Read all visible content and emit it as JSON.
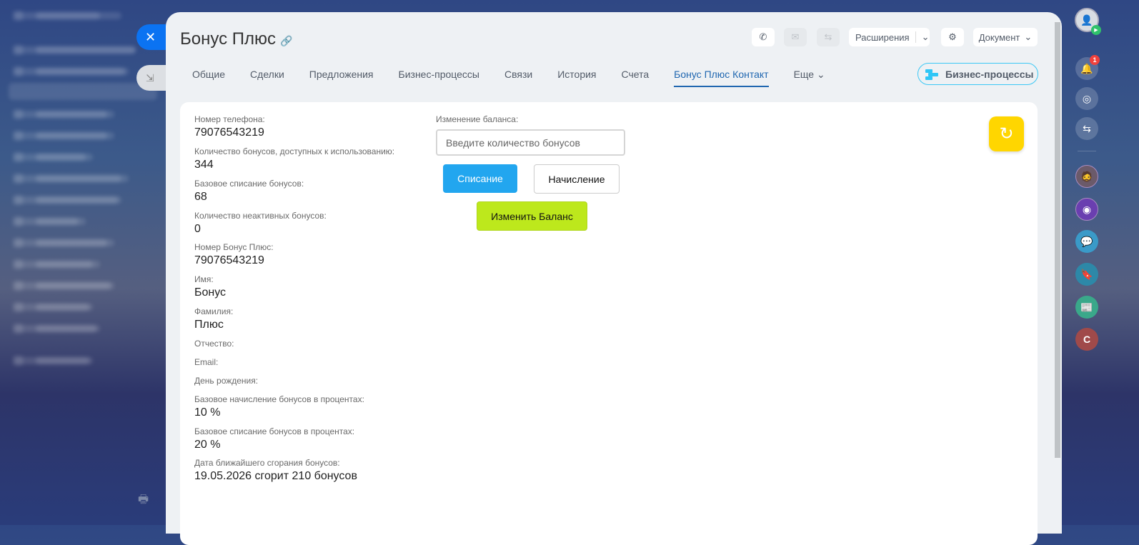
{
  "header": {
    "title": "Бонус Плюс",
    "toolbar": {
      "extensions": "Расширения",
      "document": "Документ"
    }
  },
  "tabs": [
    {
      "label": "Общие"
    },
    {
      "label": "Сделки"
    },
    {
      "label": "Предложения"
    },
    {
      "label": "Бизнес-процессы"
    },
    {
      "label": "Связи"
    },
    {
      "label": "История"
    },
    {
      "label": "Счета"
    },
    {
      "label": "Бонус Плюс Контакт"
    },
    {
      "label": "Еще"
    }
  ],
  "business_process_button": "Бизнес-процессы",
  "fields": [
    {
      "label": "Номер телефона:",
      "value": "79076543219"
    },
    {
      "label": "Количество бонусов, доступных к использованию:",
      "value": "344"
    },
    {
      "label": "Базовое списание бонусов:",
      "value": "68"
    },
    {
      "label": "Количество неактивных бонусов:",
      "value": "0"
    },
    {
      "label": "Номер Бонус Плюс:",
      "value": "79076543219"
    },
    {
      "label": "Имя:",
      "value": "Бонус"
    },
    {
      "label": "Фамилия:",
      "value": "Плюс"
    },
    {
      "label": "Отчество:",
      "value": ""
    },
    {
      "label": "Email:",
      "value": ""
    },
    {
      "label": "День рождения:",
      "value": ""
    },
    {
      "label": "Базовое начисление бонусов в процентах:",
      "value": "10 %"
    },
    {
      "label": "Базовое списание бонусов в процентах:",
      "value": "20 %"
    },
    {
      "label": "Дата ближайшего сгорания бонусов:",
      "value": "19.05.2026 сгорит 210 бонусов"
    }
  ],
  "balance": {
    "label": "Изменение баланса:",
    "placeholder": "Введите количество бонусов",
    "debit": "Списание",
    "credit": "Начисление",
    "apply": "Изменить Баланс"
  },
  "rail": {
    "notifications_count": "1",
    "avatar_letter": "C"
  },
  "colors": {
    "accent": "#2067b0",
    "debit": "#22a6ef",
    "apply": "#bde81c",
    "refresh": "#ffd600"
  }
}
